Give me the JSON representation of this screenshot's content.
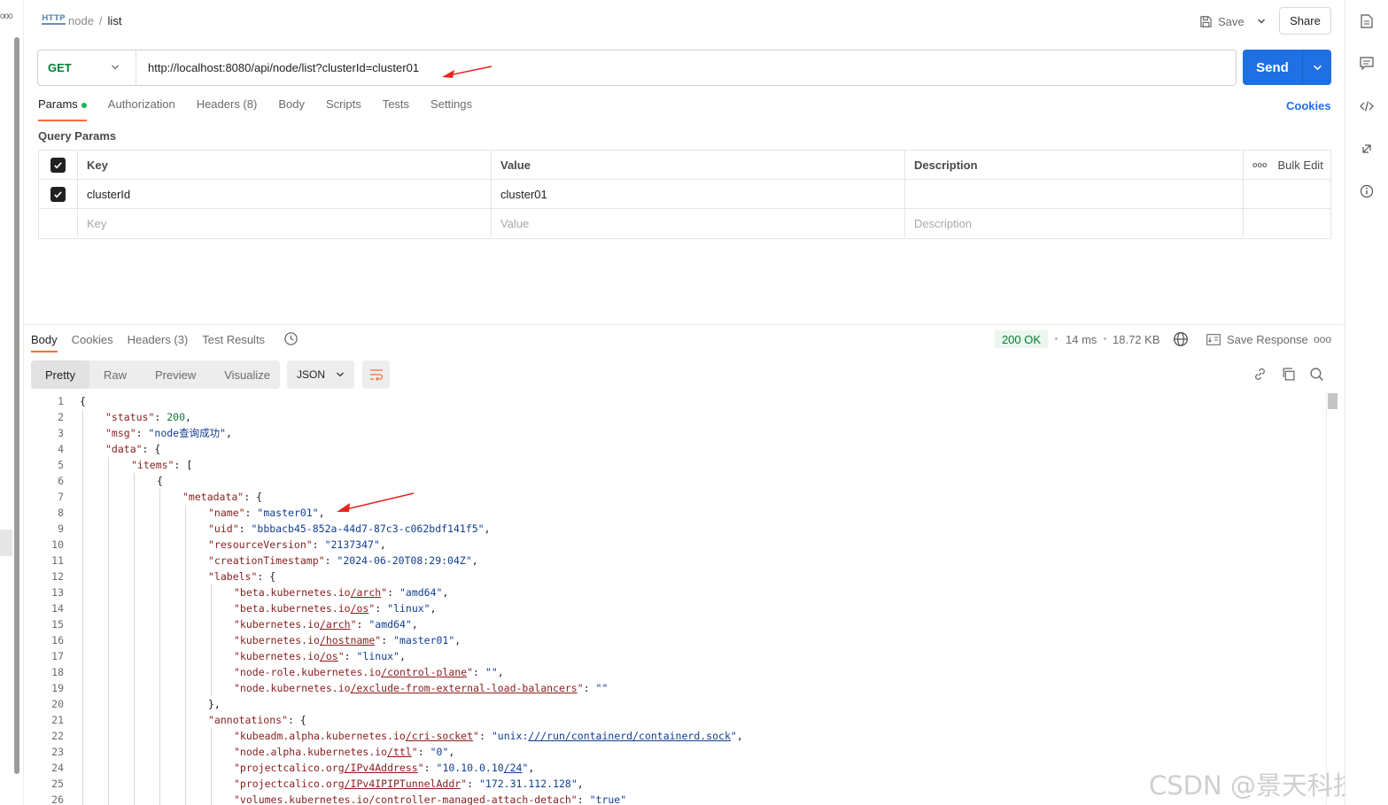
{
  "header": {
    "protocol_badge": "HTTP",
    "breadcrumb_parent": "node",
    "breadcrumb_separator": "/",
    "breadcrumb_current": "list",
    "save_label": "Save",
    "share_label": "Share"
  },
  "request": {
    "method": "GET",
    "url": "http://localhost:8080/api/node/list?clusterId=cluster01",
    "send_label": "Send",
    "tabs": [
      {
        "label": "Params"
      },
      {
        "label": "Authorization"
      },
      {
        "label": "Headers (8)"
      },
      {
        "label": "Body"
      },
      {
        "label": "Scripts"
      },
      {
        "label": "Tests"
      },
      {
        "label": "Settings"
      }
    ],
    "cookies_label": "Cookies",
    "query_params_title": "Query Params",
    "table_headers": {
      "key": "Key",
      "value": "Value",
      "description": "Description",
      "bulk_edit": "Bulk Edit"
    },
    "params": [
      {
        "key": "clusterId",
        "value": "cluster01",
        "description": "",
        "checked": true
      }
    ],
    "placeholders": {
      "key": "Key",
      "value": "Value",
      "description": "Description"
    }
  },
  "response": {
    "tabs": [
      {
        "label": "Body"
      },
      {
        "label": "Cookies"
      },
      {
        "label": "Headers (3)"
      },
      {
        "label": "Test Results"
      }
    ],
    "status": "200 OK",
    "time": "14 ms",
    "size": "18.72 KB",
    "save_response_label": "Save Response",
    "views": [
      {
        "label": "Pretty"
      },
      {
        "label": "Raw"
      },
      {
        "label": "Preview"
      },
      {
        "label": "Visualize"
      }
    ],
    "format": "JSON",
    "lines": [
      {
        "n": "1",
        "indent": 0,
        "html": "{"
      },
      {
        "n": "2",
        "indent": 1,
        "html": "<span class=\"k\">\"status\"</span>: <span class=\"n\">200</span>,"
      },
      {
        "n": "3",
        "indent": 1,
        "html": "<span class=\"k\">\"msg\"</span>: <span class=\"s\">\"node查询成功\"</span>,"
      },
      {
        "n": "4",
        "indent": 1,
        "html": "<span class=\"k\">\"data\"</span>: {"
      },
      {
        "n": "5",
        "indent": 2,
        "html": "<span class=\"k\">\"items\"</span>: ["
      },
      {
        "n": "6",
        "indent": 3,
        "html": "{"
      },
      {
        "n": "7",
        "indent": 4,
        "html": "<span class=\"k\">\"metadata\"</span>: {"
      },
      {
        "n": "8",
        "indent": 5,
        "html": "<span class=\"k\">\"name\"</span>: <span class=\"s\">\"master01\"</span>,"
      },
      {
        "n": "9",
        "indent": 5,
        "html": "<span class=\"k\">\"uid\"</span>: <span class=\"s\">\"bbbacb45-852a-44d7-87c3-c062bdf141f5\"</span>,"
      },
      {
        "n": "10",
        "indent": 5,
        "html": "<span class=\"k\">\"resourceVersion\"</span>: <span class=\"s\">\"2137347\"</span>,"
      },
      {
        "n": "11",
        "indent": 5,
        "html": "<span class=\"k\">\"creationTimestamp\"</span>: <span class=\"s\">\"2024-06-20T08:29:04Z\"</span>,"
      },
      {
        "n": "12",
        "indent": 5,
        "html": "<span class=\"k\">\"labels\"</span>: {"
      },
      {
        "n": "13",
        "indent": 6,
        "html": "<span class=\"k\">\"beta.kubernetes.io<span class=\"u\">/arch</span>\"</span>: <span class=\"s\">\"amd64\"</span>,"
      },
      {
        "n": "14",
        "indent": 6,
        "html": "<span class=\"k\">\"beta.kubernetes.io<span class=\"u\">/os</span>\"</span>: <span class=\"s\">\"linux\"</span>,"
      },
      {
        "n": "15",
        "indent": 6,
        "html": "<span class=\"k\">\"kubernetes.io<span class=\"u\">/arch</span>\"</span>: <span class=\"s\">\"amd64\"</span>,"
      },
      {
        "n": "16",
        "indent": 6,
        "html": "<span class=\"k\">\"kubernetes.io<span class=\"u\">/hostname</span>\"</span>: <span class=\"s\">\"master01\"</span>,"
      },
      {
        "n": "17",
        "indent": 6,
        "html": "<span class=\"k\">\"kubernetes.io<span class=\"u\">/os</span>\"</span>: <span class=\"s\">\"linux\"</span>,"
      },
      {
        "n": "18",
        "indent": 6,
        "html": "<span class=\"k\">\"node-role.kubernetes.io<span class=\"u\">/control-plane</span>\"</span>: <span class=\"s\">\"\"</span>,"
      },
      {
        "n": "19",
        "indent": 6,
        "html": "<span class=\"k\">\"node.kubernetes.io<span class=\"u\">/exclude-from-external-load-balancers</span>\"</span>: <span class=\"s\">\"\"</span>"
      },
      {
        "n": "20",
        "indent": 5,
        "html": "},"
      },
      {
        "n": "21",
        "indent": 5,
        "html": "<span class=\"k\">\"annotations\"</span>: {"
      },
      {
        "n": "22",
        "indent": 6,
        "html": "<span class=\"k\">\"kubeadm.alpha.kubernetes.io<span class=\"u\">/cri-socket</span>\"</span>: <span class=\"s\">\"unix:<span class=\"u\">///run/containerd/containerd.sock</span>\"</span>,"
      },
      {
        "n": "23",
        "indent": 6,
        "html": "<span class=\"k\">\"node.alpha.kubernetes.io<span class=\"u\">/ttl</span>\"</span>: <span class=\"s\">\"0\"</span>,"
      },
      {
        "n": "24",
        "indent": 6,
        "html": "<span class=\"k\">\"projectcalico.org<span class=\"u\">/IPv4Address</span>\"</span>: <span class=\"s\">\"10.10.0.10<span class=\"u\">/24</span>\"</span>,"
      },
      {
        "n": "25",
        "indent": 6,
        "html": "<span class=\"k\">\"projectcalico.org<span class=\"u\">/IPv4IPIPTunnelAddr</span>\"</span>: <span class=\"s\">\"172.31.112.128\"</span>,"
      },
      {
        "n": "26",
        "indent": 6,
        "html": "<span class=\"k\">\"volumes.kubernetes.io/controller-managed-attach-detach\"</span>: <span class=\"s\">\"true\"</span>"
      }
    ]
  },
  "watermark": "CSDN @景天科技苑",
  "colors": {
    "accent_orange": "#ff6c37",
    "send_blue": "#1f6fe5",
    "method_green": "#007f31",
    "annotation_red": "#e8231c"
  }
}
